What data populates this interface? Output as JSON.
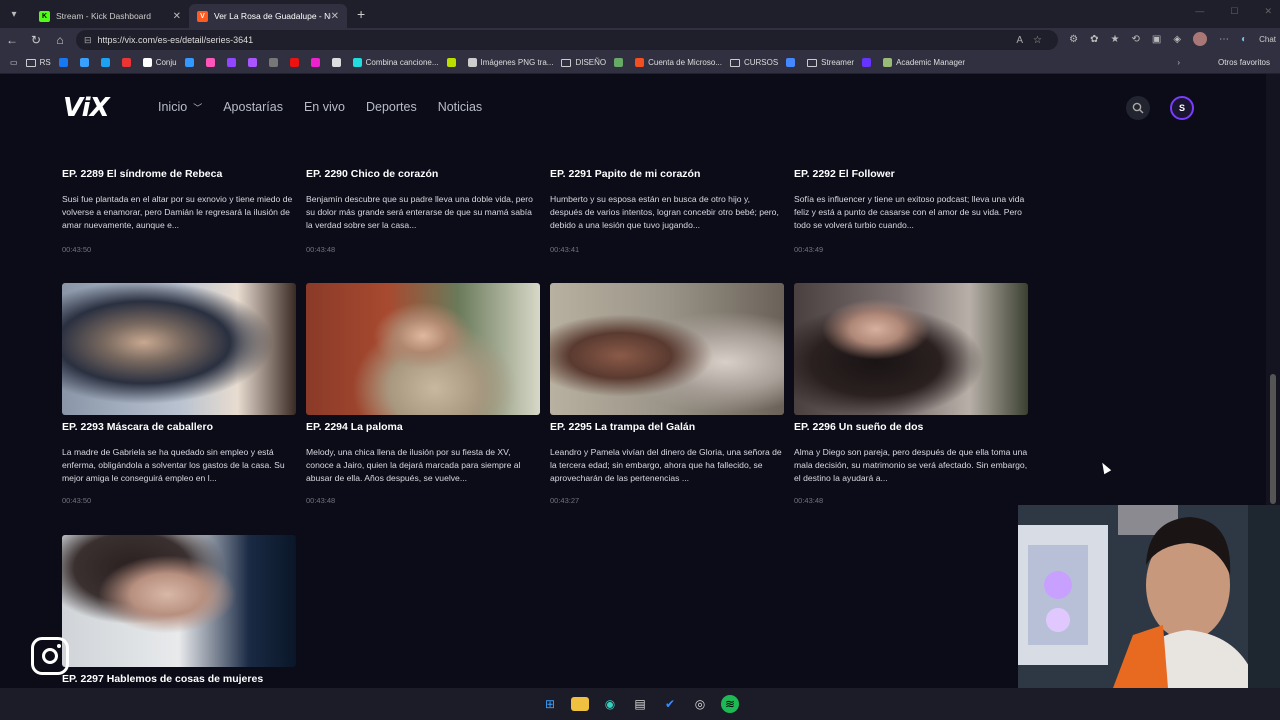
{
  "browser": {
    "tabs": [
      {
        "title": "Stream - Kick Dashboard",
        "icon": "kick-icon",
        "color": "#53fc18"
      },
      {
        "title": "Ver La Rosa de Guadalupe - Nuev",
        "icon": "vix-icon",
        "color": "#ff5a1f"
      }
    ],
    "url": "https://vix.com/es-es/detail/series-3641",
    "chat_label": "Chat",
    "bookmarks": [
      {
        "label": "RS",
        "icon": "rs-icon",
        "color": "#888"
      },
      {
        "label": "Conju",
        "icon": "google-icon",
        "color": "#4285f4"
      },
      {
        "label": "Combina cancione...",
        "icon": "music-icon",
        "color": "#2dd"
      },
      {
        "label": "Imágenes PNG tra...",
        "icon": "png-icon",
        "color": "#ccc"
      },
      {
        "label": "DISEÑO",
        "icon": "folder-icon",
        "color": "#ccc"
      },
      {
        "label": "Cuenta de Microso...",
        "icon": "microsoft-icon",
        "color": "#f25022"
      },
      {
        "label": "CURSOS",
        "icon": "folder-icon",
        "color": "#ccc"
      },
      {
        "label": "Streamer",
        "icon": "folder-icon",
        "color": "#ccc"
      },
      {
        "label": "Academic Manager",
        "icon": "academic-icon",
        "color": "#9b7"
      }
    ],
    "other_bookmarks": "Otros favoritos"
  },
  "site": {
    "logo": "ViX",
    "nav": [
      "Inicio",
      "Apostarías",
      "En vivo",
      "Deportes",
      "Noticias"
    ],
    "profile_initial": "S"
  },
  "episodes": [
    {
      "title": "EP. 2289  El síndrome de Rebeca",
      "desc": "Susi fue plantada en el altar por su exnovio y tiene miedo de volverse a enamorar, pero Damián le regresará la ilusión de amar nuevamente, aunque e...",
      "duration": "00:43:50"
    },
    {
      "title": "EP. 2290  Chico de corazón",
      "desc": "Benjamín descubre que su padre lleva una doble vida, pero su dolor más grande será enterarse de que su mamá sabía la verdad sobre ser la casa...",
      "duration": "00:43:48"
    },
    {
      "title": "EP. 2291  Papito de mi corazón",
      "desc": "Humberto y su esposa están en busca de otro hijo y, después de varios intentos, logran concebir otro bebé; pero, debido a una lesión que tuvo jugando...",
      "duration": "00:43:41"
    },
    {
      "title": "EP. 2292  El Follower",
      "desc": "Sofía es influencer y tiene un exitoso podcast; lleva una vida feliz y está a punto de casarse con el amor de su vida. Pero todo se volverá turbio cuando...",
      "duration": "00:43:49"
    },
    {
      "title": "EP. 2293  Máscara de caballero",
      "desc": "La madre de Gabriela se ha quedado sin empleo y está enferma, obligándola a solventar los gastos de la casa. Su mejor amiga le conseguirá empleo en l...",
      "duration": "00:43:50"
    },
    {
      "title": "EP. 2294  La paloma",
      "desc": "Melody, una chica llena de ilusión por su fiesta de XV, conoce a Jairo, quien la dejará marcada para siempre al abusar de ella. Años después, se vuelve...",
      "duration": "00:43:48"
    },
    {
      "title": "EP. 2295  La trampa del Galán",
      "desc": "Leandro y Pamela vivían del dinero de Gloria, una señora de la tercera edad; sin embargo, ahora que ha fallecido, se aprovecharán de las pertenencias ...",
      "duration": "00:43:27"
    },
    {
      "title": "EP. 2296  Un sueño de dos",
      "desc": "Alma y Diego son pareja, pero después de que ella toma una mala decisión, su matrimonio se verá afectado. Sin embargo, el destino la ayudará a...",
      "duration": "00:43:48"
    },
    {
      "title": "EP. 2297  Hablemos de cosas de mujeres",
      "desc": "",
      "duration": ""
    }
  ]
}
